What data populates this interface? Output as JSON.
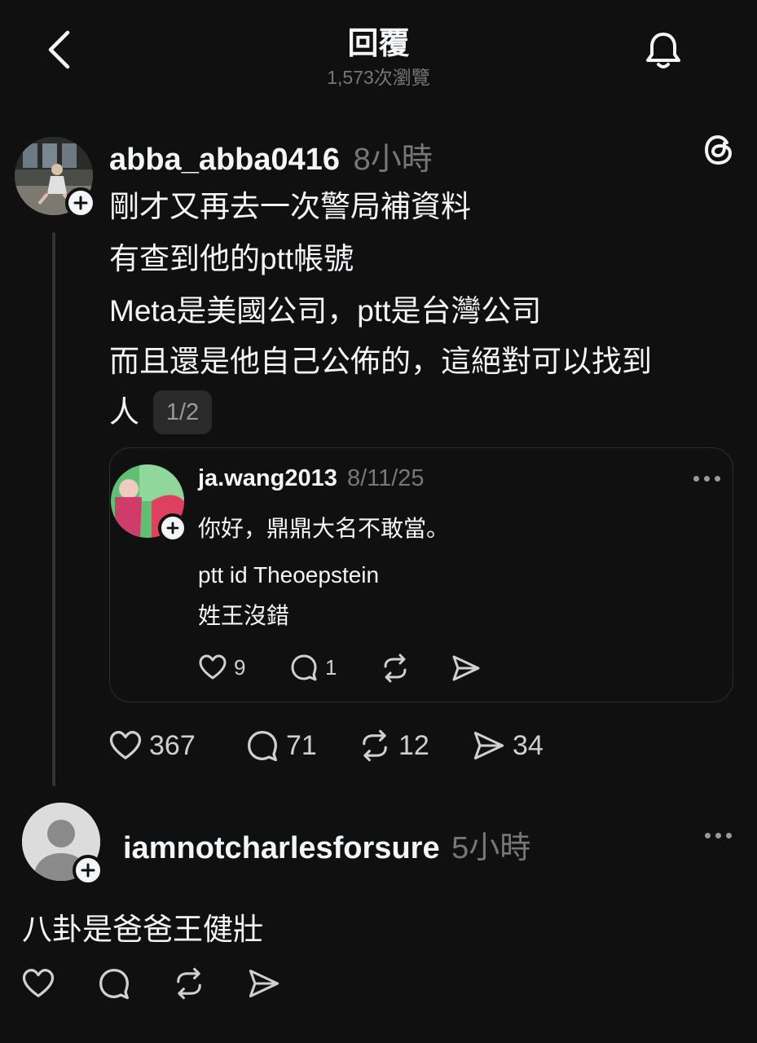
{
  "header": {
    "title": "回覆",
    "views": "1,573次瀏覽"
  },
  "post": {
    "username": "abba_abba0416",
    "time": "8小時",
    "lines": [
      "剛才又再去一次警局補資料",
      "有查到他的ptt帳號",
      "Meta是美國公司，ptt是台灣公司",
      "而且還是他自己公佈的，這絕對可以找到",
      "人"
    ],
    "page_indicator": "1/2",
    "quote": {
      "username": "ja.wang2013",
      "date": "8/11/25",
      "line1": "你好，鼎鼎大名不敢當。",
      "line2": "ptt id Theoepstein",
      "line3": "姓王沒錯",
      "likes": "9",
      "replies": "1"
    },
    "likes": "367",
    "replies": "71",
    "reposts": "12",
    "shares": "34"
  },
  "reply": {
    "username": "iamnotcharlesforsure",
    "time": "5小時",
    "text": "八卦是爸爸王健壯"
  },
  "icons": {
    "back": "chevron-left-icon",
    "bell": "bell-icon",
    "threads": "threads-logo-icon",
    "like": "heart-icon",
    "reply": "comment-icon",
    "repost": "repost-icon",
    "share": "send-icon",
    "more": "more-dots-icon"
  }
}
